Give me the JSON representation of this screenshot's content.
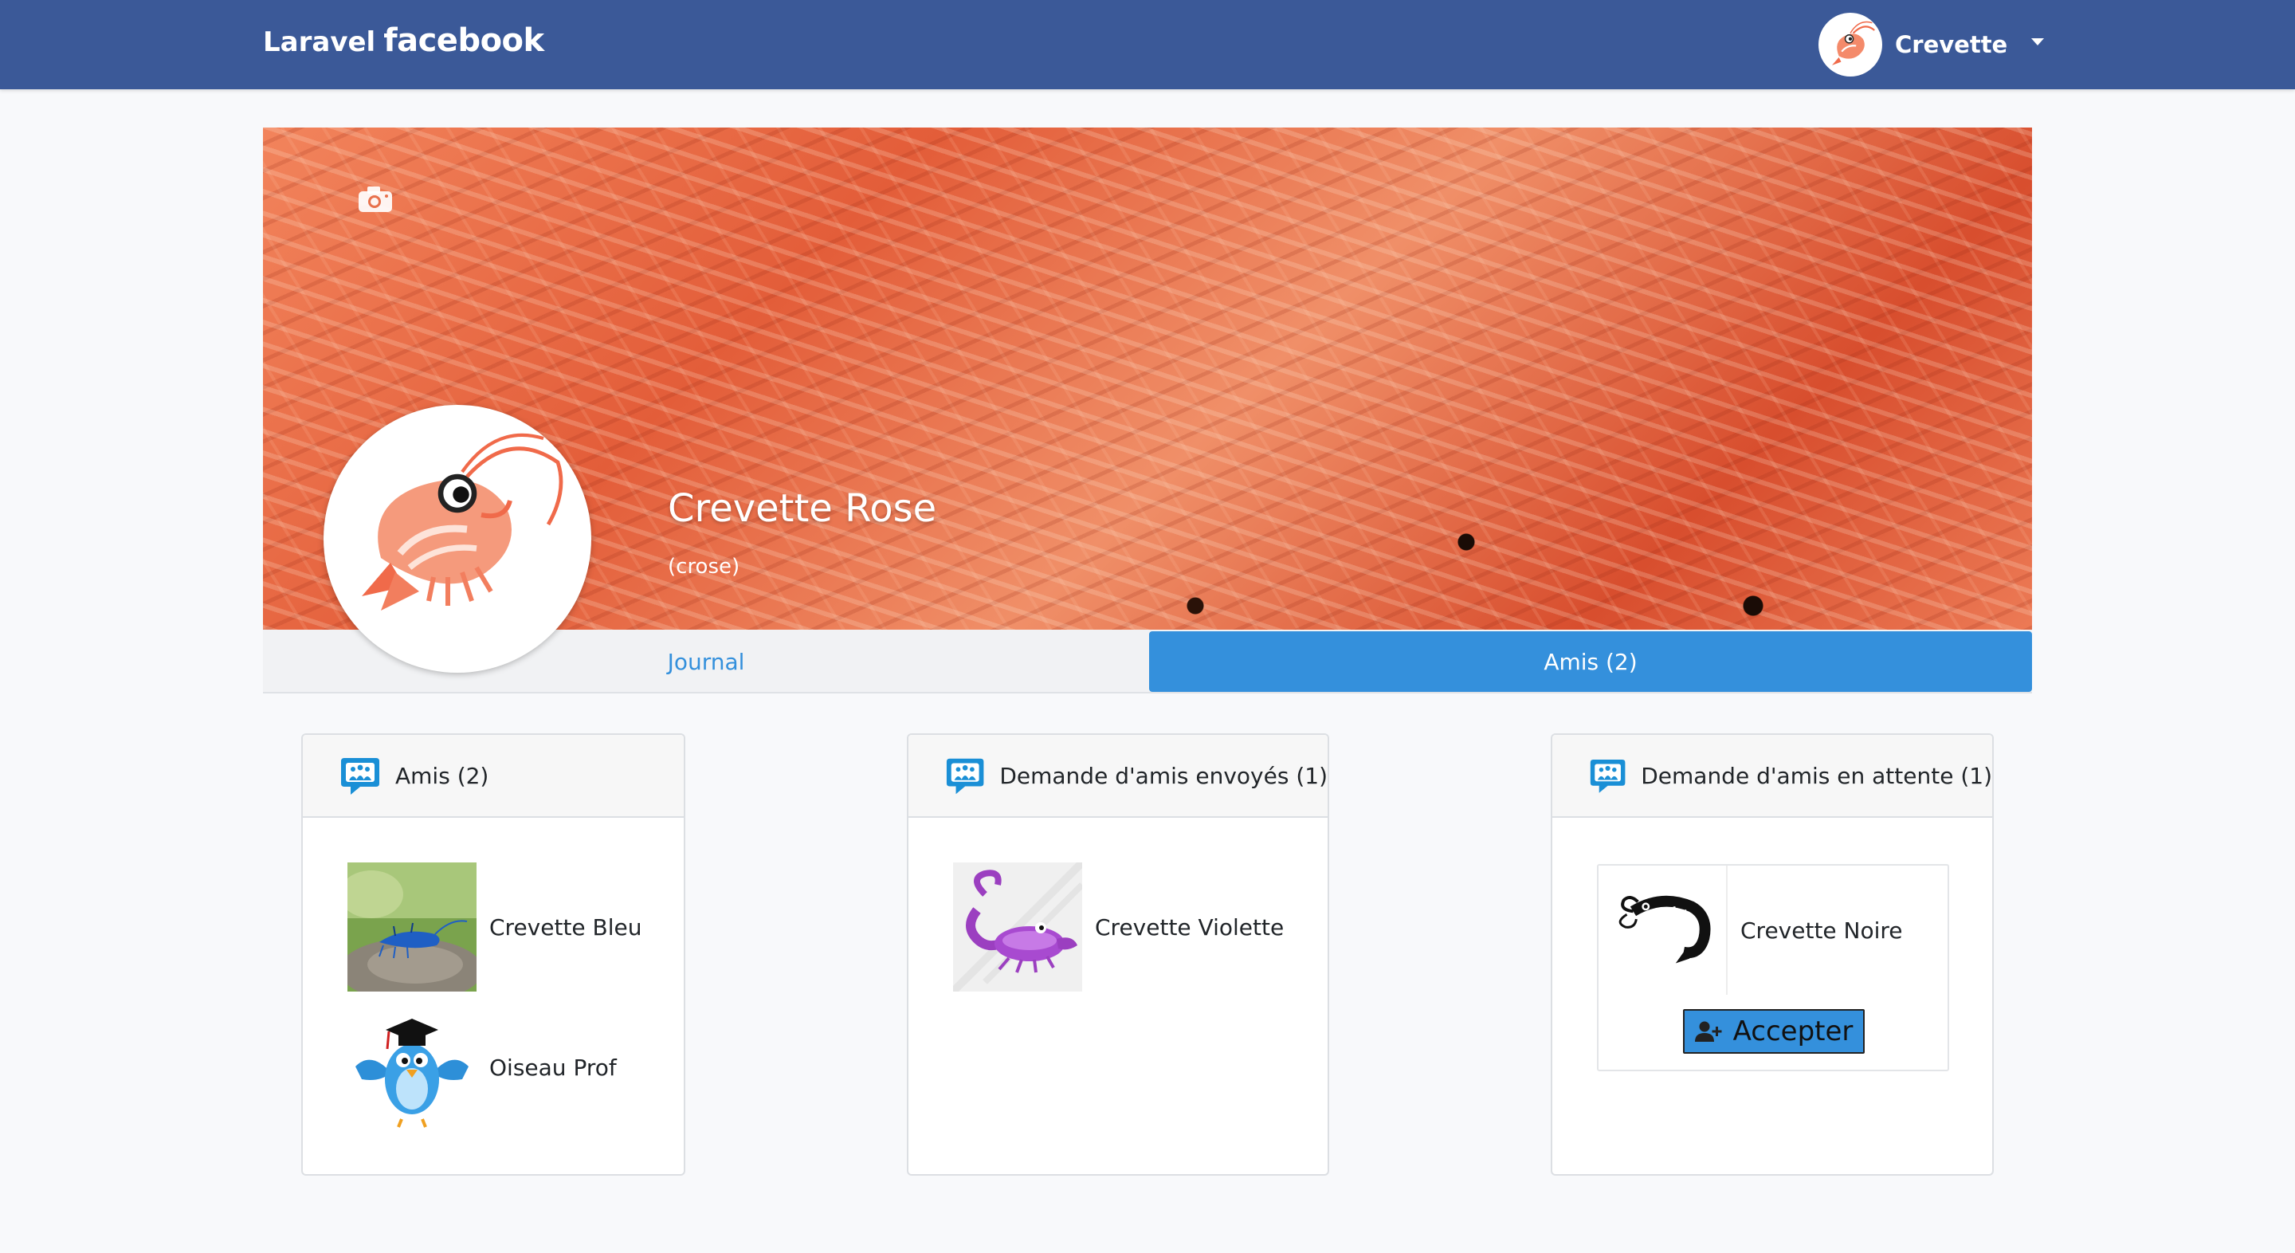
{
  "navbar": {
    "brand_laravel": "Laravel",
    "brand_facebook": "facebook",
    "user_name": "Crevette",
    "user_icon": "shrimp-avatar-icon",
    "dropdown_icon": "caret-down-icon",
    "color": "#3b5998"
  },
  "profile": {
    "name": "Crevette Rose",
    "username": "(crose)",
    "cover_icon": "camera-icon",
    "avatar_icon": "shrimp-avatar-icon"
  },
  "tabs": [
    {
      "label": "Journal",
      "active": false
    },
    {
      "label": "Amis (2)",
      "active": true
    }
  ],
  "cards": {
    "friends": {
      "title": "Amis (2)",
      "icon": "friends-chat-icon",
      "items": [
        {
          "name": "Crevette Bleu",
          "icon": "blue-shrimp-photo"
        },
        {
          "name": "Oiseau Prof",
          "icon": "bird-graduate-icon"
        }
      ]
    },
    "sent": {
      "title": "Demande d'amis envoyés (1)",
      "icon": "friends-chat-icon",
      "items": [
        {
          "name": "Crevette Violette",
          "icon": "purple-scorpion-icon"
        }
      ]
    },
    "pending": {
      "title": "Demande d'amis en attente (1)",
      "icon": "friends-chat-icon",
      "items": [
        {
          "name": "Crevette Noire",
          "icon": "black-shrimp-icon"
        }
      ],
      "accept_label": "Accepter",
      "accept_icon": "user-plus-icon"
    }
  },
  "colors": {
    "accent": "#3490dc",
    "background": "#f8f9fb"
  }
}
